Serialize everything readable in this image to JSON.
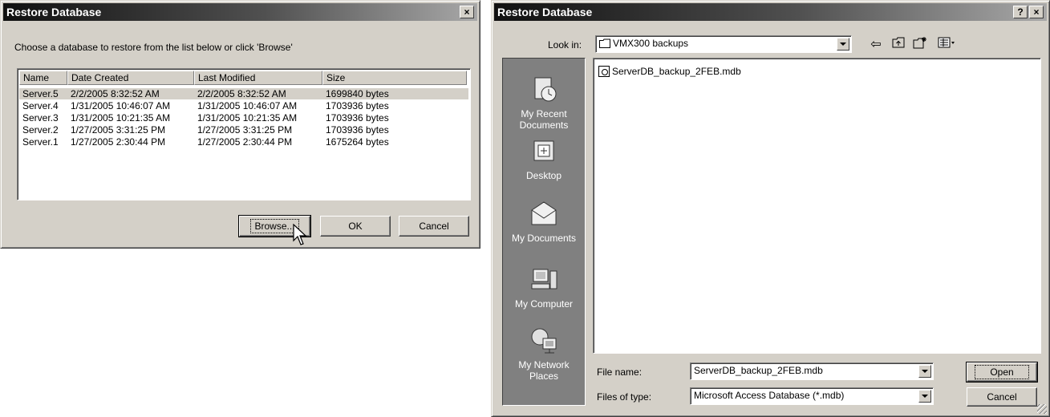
{
  "restore_dialog": {
    "title": "Restore Database",
    "close_glyph": "×",
    "prompt": "Choose a database to restore from the list below or click 'Browse'",
    "columns": [
      "Name",
      "Date Created",
      "Last Modified",
      "Size"
    ],
    "rows": [
      [
        "Server.5",
        "2/2/2005 8:32:52 AM",
        "2/2/2005 8:32:52 AM",
        "1699840 bytes"
      ],
      [
        "Server.4",
        "1/31/2005 10:46:07 AM",
        "1/31/2005 10:46:07 AM",
        "1703936 bytes"
      ],
      [
        "Server.3",
        "1/31/2005 10:21:35 AM",
        "1/31/2005 10:21:35 AM",
        "1703936 bytes"
      ],
      [
        "Server.2",
        "1/27/2005 3:31:25 PM",
        "1/27/2005 3:31:25 PM",
        "1703936 bytes"
      ],
      [
        "Server.1",
        "1/27/2005 2:30:44 PM",
        "1/27/2005 2:30:44 PM",
        "1675264 bytes"
      ]
    ],
    "selected_row": 0,
    "buttons": {
      "browse": "Browse...",
      "ok": "OK",
      "cancel": "Cancel"
    }
  },
  "open_dialog": {
    "title": "Restore Database",
    "help_glyph": "?",
    "close_glyph": "×",
    "look_in_label": "Look in:",
    "look_in_value": "VMX300 backups",
    "toolbar_icons": [
      "back-icon",
      "up-folder-icon",
      "new-folder-icon",
      "view-menu-icon"
    ],
    "places": [
      {
        "label": "My Recent Documents",
        "icon": "recent-documents-icon"
      },
      {
        "label": "Desktop",
        "icon": "desktop-icon"
      },
      {
        "label": "My Documents",
        "icon": "my-documents-icon"
      },
      {
        "label": "My Computer",
        "icon": "my-computer-icon"
      },
      {
        "label": "My Network Places",
        "icon": "network-places-icon"
      }
    ],
    "files": [
      "ServerDB_backup_2FEB.mdb"
    ],
    "file_name_label": "File name:",
    "file_name_value": "ServerDB_backup_2FEB.mdb",
    "files_of_type_label": "Files of type:",
    "files_of_type_value": "Microsoft Access Database (*.mdb)",
    "buttons": {
      "open": "Open",
      "cancel": "Cancel"
    }
  }
}
